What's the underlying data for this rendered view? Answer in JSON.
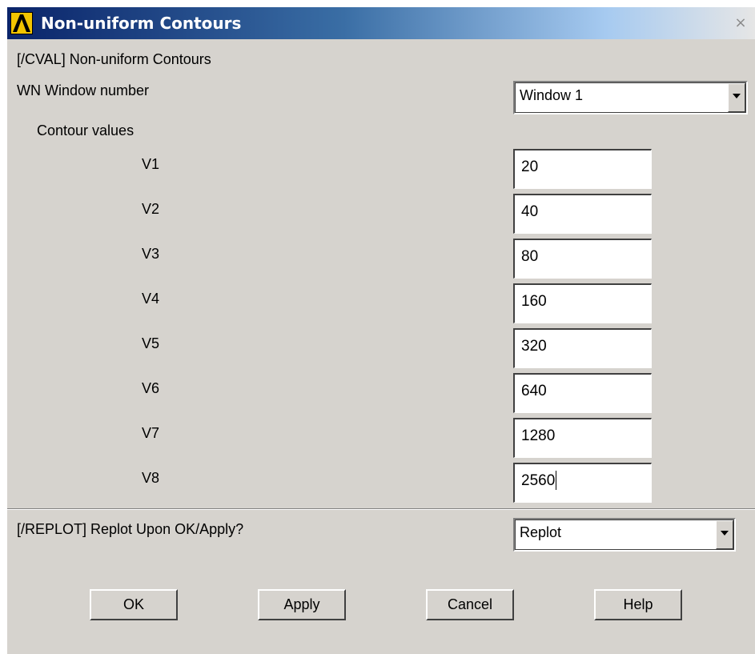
{
  "window": {
    "title": "Non-uniform Contours",
    "close_glyph": "×"
  },
  "header": {
    "command_label": "[/CVAL]  Non-uniform Contours"
  },
  "window_number": {
    "label": "WN  Window number",
    "selected": "Window 1"
  },
  "contours": {
    "section_label": "Contour values",
    "fields": [
      {
        "label": "V1",
        "value": "20"
      },
      {
        "label": "V2",
        "value": "40"
      },
      {
        "label": "V3",
        "value": "80"
      },
      {
        "label": "V4",
        "value": "160"
      },
      {
        "label": "V5",
        "value": "320"
      },
      {
        "label": "V6",
        "value": "640"
      },
      {
        "label": "V7",
        "value": "1280"
      },
      {
        "label": "V8",
        "value": "2560"
      }
    ]
  },
  "replot": {
    "label": "[/REPLOT]  Replot Upon OK/Apply?",
    "selected": "Replot"
  },
  "buttons": {
    "ok": "OK",
    "apply": "Apply",
    "cancel": "Cancel",
    "help": "Help"
  },
  "icons": {
    "app": "ansys-logo-icon",
    "close": "close-icon",
    "dropdown": "chevron-down-icon"
  },
  "colors": {
    "dialog_bg": "#d6d3ce",
    "titlebar_start": "#0a246a",
    "logo_yellow": "#f2c400"
  }
}
